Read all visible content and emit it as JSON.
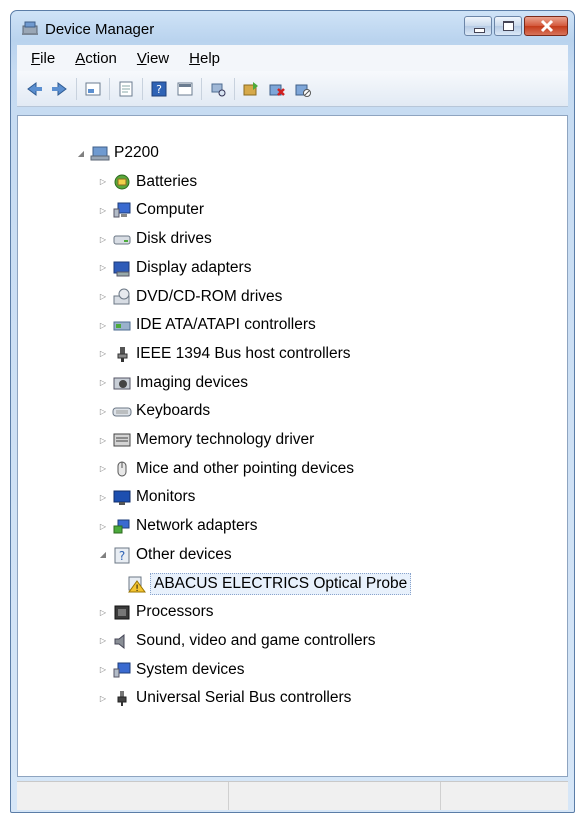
{
  "window": {
    "title": "Device Manager"
  },
  "menu": [
    "File",
    "Action",
    "View",
    "Help"
  ],
  "toolbar": {
    "buttons": [
      "back-icon",
      "forward-icon",
      "sep",
      "properties-icon",
      "sep",
      "help-doc-icon",
      "sep",
      "help-icon",
      "view-icon",
      "sep",
      "scan-hardware-icon",
      "sep",
      "update-driver-icon",
      "uninstall-icon",
      "disable-icon"
    ]
  },
  "tree": {
    "root": "P2200",
    "categories": [
      {
        "label": "Batteries",
        "icon": "battery-icon"
      },
      {
        "label": "Computer",
        "icon": "computer-icon"
      },
      {
        "label": "Disk drives",
        "icon": "disk-drive-icon"
      },
      {
        "label": "Display adapters",
        "icon": "display-adapter-icon"
      },
      {
        "label": "DVD/CD-ROM drives",
        "icon": "dvd-drive-icon"
      },
      {
        "label": "IDE ATA/ATAPI controllers",
        "icon": "ide-controller-icon"
      },
      {
        "label": "IEEE 1394 Bus host controllers",
        "icon": "ieee1394-icon"
      },
      {
        "label": "Imaging devices",
        "icon": "imaging-device-icon"
      },
      {
        "label": "Keyboards",
        "icon": "keyboard-icon"
      },
      {
        "label": "Memory technology driver",
        "icon": "memory-icon"
      },
      {
        "label": "Mice and other pointing devices",
        "icon": "mouse-icon"
      },
      {
        "label": "Monitors",
        "icon": "monitor-icon"
      },
      {
        "label": "Network adapters",
        "icon": "network-adapter-icon"
      },
      {
        "label": "Other devices",
        "icon": "unknown-device-icon",
        "expanded": true
      },
      {
        "label": "ABACUS ELECTRICS Optical Probe",
        "icon": "warning-device-icon",
        "child": true,
        "selected": true
      },
      {
        "label": "Processors",
        "icon": "processor-icon"
      },
      {
        "label": "Sound, video and game controllers",
        "icon": "sound-icon"
      },
      {
        "label": "System devices",
        "icon": "system-device-icon"
      },
      {
        "label": "Universal Serial Bus controllers",
        "icon": "usb-icon"
      }
    ]
  },
  "colors": {
    "accent": "#3a6ea5",
    "selection": "#e8f1fc"
  }
}
